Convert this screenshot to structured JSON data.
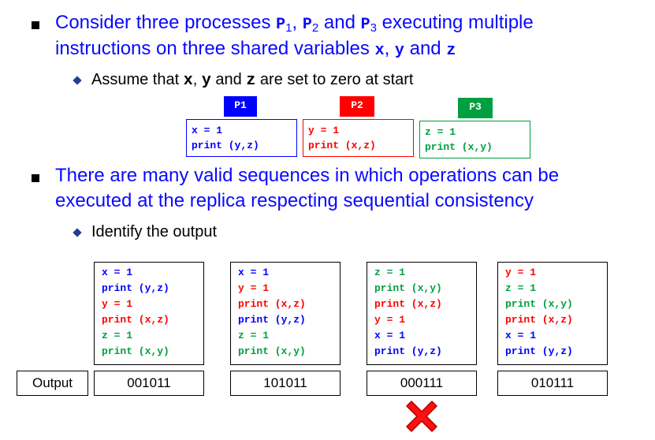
{
  "bullet1": {
    "pre": "Consider three processes ",
    "p": "P",
    "sub1": "1",
    "sep1": ",  ",
    "sub2": "2",
    "and1": " and ",
    "sub3": "3",
    "post": " executing multiple",
    "line2_pre": "instructions on three shared variables ",
    "x": "x",
    "comma": ", ",
    "y": "y",
    "and2": " and ",
    "z": "z"
  },
  "sub1": {
    "pre": "Assume that ",
    "x": "x",
    "comma": ", ",
    "y": "y",
    "and": " and ",
    "z": "z",
    "post": " are set to zero at start"
  },
  "processes": [
    {
      "label": "P1",
      "color": "#0000ff",
      "lines": [
        "x = 1",
        "print (y,z)"
      ]
    },
    {
      "label": "P2",
      "color": "#ff0000",
      "lines": [
        "y = 1",
        "print (x,z)"
      ]
    },
    {
      "label": "P3",
      "color": "#00a040",
      "lines": [
        "z = 1",
        "print (x,y)"
      ]
    }
  ],
  "bullet2": {
    "line1": "There are many valid sequences in which operations can be",
    "line2": "executed at the replica respecting sequential consistency"
  },
  "sub2": {
    "text": "Identify the output"
  },
  "output_label": "Output",
  "sequences": [
    {
      "lines": [
        {
          "text": "x = 1",
          "color": "blue"
        },
        {
          "text": "print (y,z)",
          "color": "blue"
        },
        {
          "text": "y = 1",
          "color": "red"
        },
        {
          "text": "print (x,z)",
          "color": "red"
        },
        {
          "text": "z = 1",
          "color": "green"
        },
        {
          "text": "print (x,y)",
          "color": "green"
        }
      ],
      "output": "001011"
    },
    {
      "lines": [
        {
          "text": "x = 1",
          "color": "blue"
        },
        {
          "text": "y = 1",
          "color": "red"
        },
        {
          "text": "print (x,z)",
          "color": "red"
        },
        {
          "text": "print (y,z)",
          "color": "blue"
        },
        {
          "text": "z = 1",
          "color": "green"
        },
        {
          "text": "print (x,y)",
          "color": "green"
        }
      ],
      "output": "101011"
    },
    {
      "lines": [
        {
          "text": "z = 1",
          "color": "green"
        },
        {
          "text": "print (x,y)",
          "color": "green"
        },
        {
          "text": "print (x,z)",
          "color": "red"
        },
        {
          "text": "y = 1",
          "color": "red"
        },
        {
          "text": "x = 1",
          "color": "blue"
        },
        {
          "text": "print (y,z)",
          "color": "blue"
        }
      ],
      "output": "000111",
      "invalid": true
    },
    {
      "lines": [
        {
          "text": "y = 1",
          "color": "red"
        },
        {
          "text": "z = 1",
          "color": "green"
        },
        {
          "text": "print (x,y)",
          "color": "green"
        },
        {
          "text": "print (x,z)",
          "color": "red"
        },
        {
          "text": "x = 1",
          "color": "blue"
        },
        {
          "text": "print (y,z)",
          "color": "blue"
        }
      ],
      "output": "010111"
    }
  ],
  "invalid_marker_icon": "red-x-icon"
}
